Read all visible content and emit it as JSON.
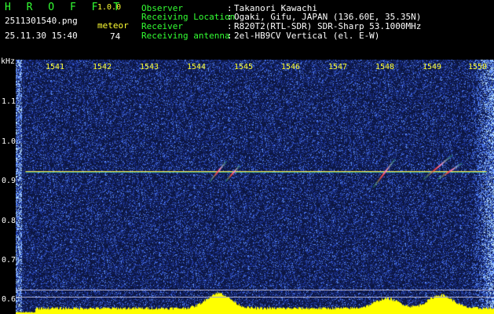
{
  "header": {
    "app_title": "H R O F F T",
    "app_version": "1.0.0",
    "filename": "2511301540.png",
    "timestamp": "25.11.30 15:40",
    "meteor_label": "meteor",
    "meteor_count": "74"
  },
  "info": [
    {
      "label": "Observer",
      "value": "Takanori Kawachi"
    },
    {
      "label": "Receiving Location",
      "value": "Ogaki, Gifu, JAPAN (136.60E, 35.35N)"
    },
    {
      "label": "Receiver",
      "value": "R820T2(RTL-SDR) SDR-Sharp 53.1000MHz"
    },
    {
      "label": "Receiving antenna",
      "value": "2el-HB9CV Vertical (el. E-W)"
    }
  ],
  "info_separator": ":",
  "axis": {
    "y_unit": "kHz",
    "y_ticks": [
      "1.1",
      "1.0",
      "0.9",
      "0.8",
      "0.7",
      "0.6"
    ],
    "x_ticks": [
      "1541",
      "1542",
      "1543",
      "1544",
      "1545",
      "1546",
      "1547",
      "1548",
      "1549",
      "1550"
    ]
  },
  "colors": {
    "background": "#000000",
    "label_green": "#33ff33",
    "text_white": "#ffffff",
    "tick_yellow": "#ffff33",
    "spectrogram_base": "#0c1640",
    "carrier_line": "#ffe040",
    "power_fill": "#ffff00"
  },
  "spectrogram": {
    "time_start_min": 1540.4,
    "time_end_min": 1550.2,
    "freq_top_khz": 1.2,
    "freq_bottom_khz": 0.573,
    "carrier_khz": 0.925,
    "carrier_start_min": 1540.6,
    "carrier_end_min": 1550.05,
    "meteor_echoes": [
      {
        "time_min": 1544.55,
        "width_min": 0.35,
        "freq_khz": 0.925,
        "slope": -0.05
      },
      {
        "time_min": 1544.85,
        "width_min": 0.3,
        "freq_khz": 0.92,
        "slope": -0.04
      },
      {
        "time_min": 1547.95,
        "width_min": 0.45,
        "freq_khz": 0.92,
        "slope": -0.07
      },
      {
        "time_min": 1549.05,
        "width_min": 0.6,
        "freq_khz": 0.935,
        "slope": -0.06
      },
      {
        "time_min": 1549.3,
        "width_min": 0.5,
        "freq_khz": 0.925,
        "slope": -0.04
      }
    ],
    "power_peaks": [
      {
        "time_min": 1544.55,
        "level": 0.85
      },
      {
        "time_min": 1548.0,
        "level": 0.55
      },
      {
        "time_min": 1549.1,
        "level": 0.75
      }
    ],
    "power_baseline": 0.25
  }
}
